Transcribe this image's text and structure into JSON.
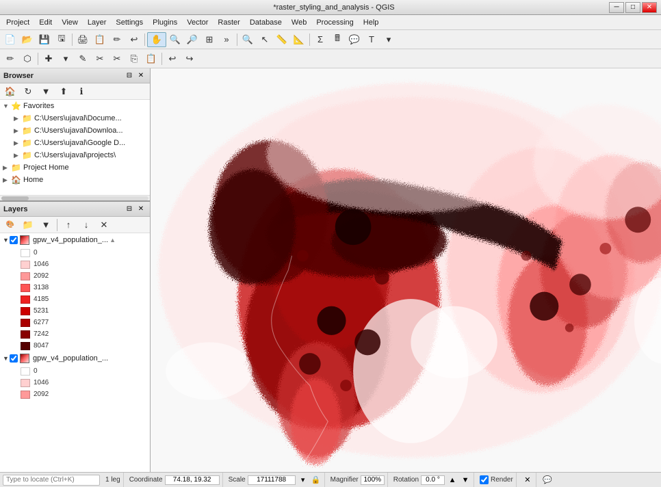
{
  "titlebar": {
    "title": "*raster_styling_and_analysis - QGIS",
    "minimize": "─",
    "maximize": "□",
    "close": "✕"
  },
  "menubar": {
    "items": [
      "Project",
      "Edit",
      "View",
      "Layer",
      "Settings",
      "Plugins",
      "Vector",
      "Raster",
      "Database",
      "Web",
      "Processing",
      "Help"
    ]
  },
  "browser_panel": {
    "title": "Browser",
    "toolbar_icons": [
      "home",
      "refresh",
      "filter",
      "collapse",
      "info"
    ],
    "tree": [
      {
        "label": "Favorites",
        "type": "group",
        "expanded": true,
        "children": [
          {
            "label": "C:\\Users\\ujaval\\Docume...",
            "type": "folder"
          },
          {
            "label": "C:\\Users\\ujaval\\Downloa...",
            "type": "folder"
          },
          {
            "label": "C:\\Users\\ujaval\\Google D...",
            "type": "folder"
          },
          {
            "label": "C:\\Users\\ujaval\\projects\\",
            "type": "folder"
          }
        ]
      },
      {
        "label": "Project Home",
        "type": "folder"
      },
      {
        "label": "Home",
        "type": "folder"
      }
    ]
  },
  "layers_panel": {
    "title": "Layers",
    "layers": [
      {
        "name": "gpw_v4_population_...",
        "visible": true,
        "type": "raster",
        "expanded": true,
        "legend": [
          {
            "value": "0",
            "color": "#FFFFFF"
          },
          {
            "value": "1046",
            "color": "#FFD0D0"
          },
          {
            "value": "2092",
            "color": "#FF9999"
          },
          {
            "value": "3138",
            "color": "#FF5555"
          },
          {
            "value": "4185",
            "color": "#EE2222"
          },
          {
            "value": "5231",
            "color": "#CC0000"
          },
          {
            "value": "6277",
            "color": "#AA0000"
          },
          {
            "value": "7242",
            "color": "#880000"
          },
          {
            "value": "8047",
            "color": "#550000"
          }
        ]
      },
      {
        "name": "gpw_v4_population_...",
        "visible": true,
        "type": "raster",
        "expanded": true,
        "legend": [
          {
            "value": "0",
            "color": "#FFFFFF"
          },
          {
            "value": "1046",
            "color": "#FFD0D0"
          },
          {
            "value": "2092",
            "color": "#FF9999"
          }
        ]
      }
    ]
  },
  "statusbar": {
    "locator_placeholder": "Type to locate (Ctrl+K)",
    "scale_label": "1 leg",
    "coordinate_label": "Coordinate",
    "coordinate_value": "74.18, 19.32",
    "scale_value": "17111788",
    "magnifier_label": "Magnifier",
    "magnifier_value": "100%",
    "rotation_label": "Rotation",
    "rotation_value": "0.0 °",
    "render_label": "Render"
  }
}
